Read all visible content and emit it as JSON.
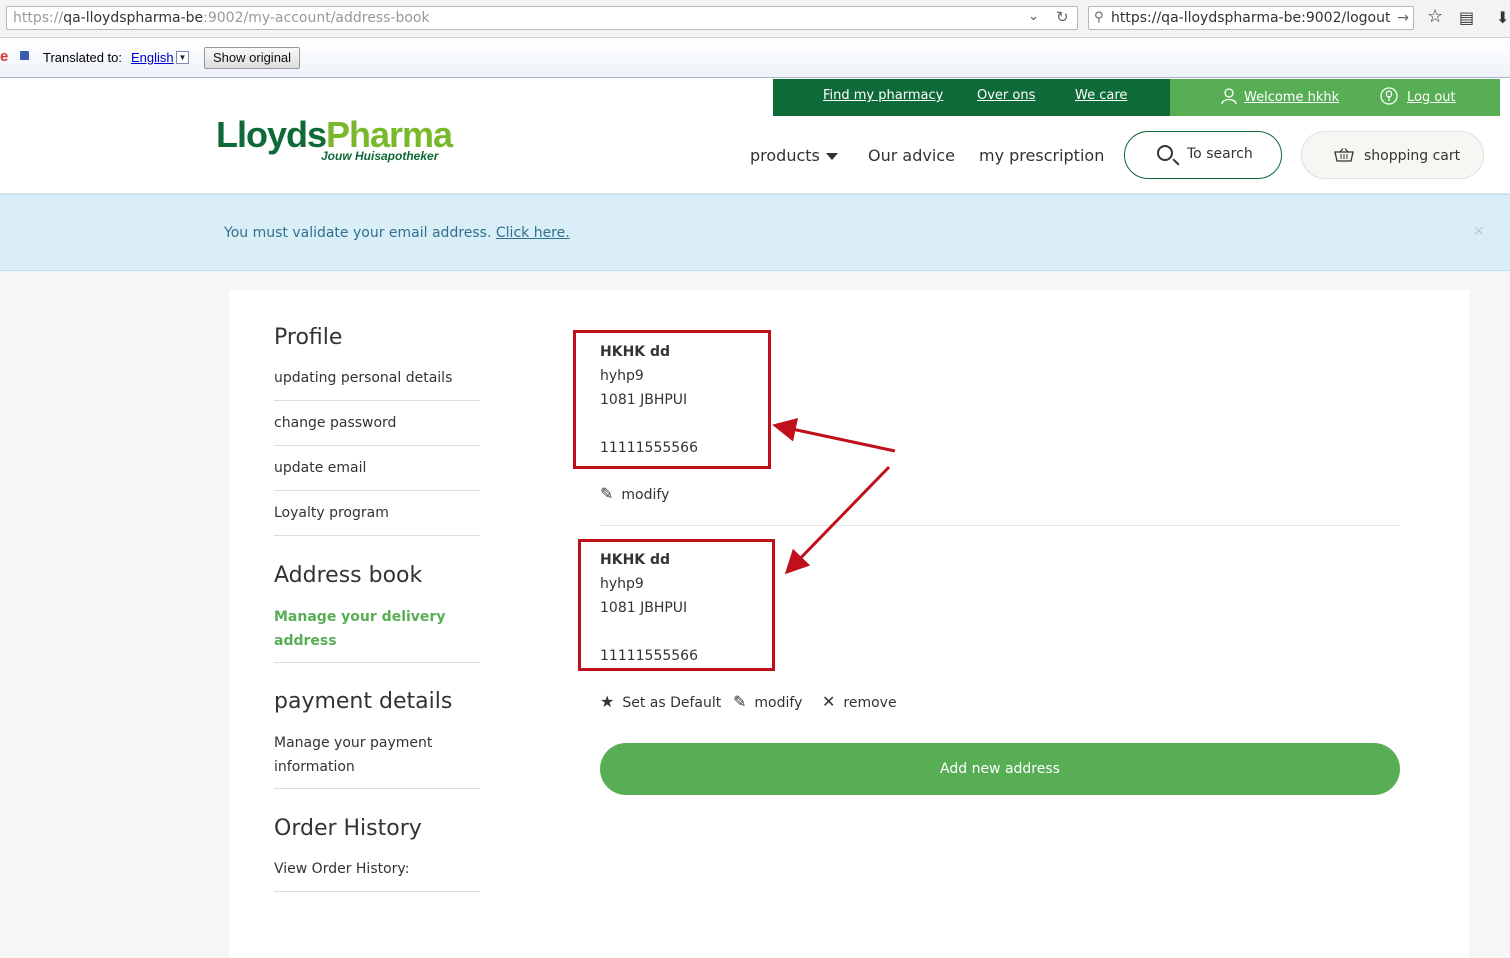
{
  "browser": {
    "url_prefix": "https://",
    "url_host": "qa-lloydspharma-be",
    "url_rest": ":9002/my-account/address-book",
    "search_value": "https://qa-lloydspharma-be:9002/logout",
    "translate": {
      "label": "Translated to:",
      "language": "English",
      "show_original": "Show original"
    }
  },
  "header": {
    "top_links": [
      "Find my pharmacy",
      "Over ons",
      "We care"
    ],
    "welcome": "Welcome hkhk",
    "logout": "Log out",
    "logo_part1": "Lloyds",
    "logo_part2": "Pharma",
    "logo_tagline": "Jouw Huisapotheker",
    "nav": {
      "products": "products",
      "advice": "Our advice",
      "prescription": "my prescription"
    },
    "search_label": "To search",
    "cart_label": "shopping cart"
  },
  "alert": {
    "message": "You must validate your email address. ",
    "link": "Click here.",
    "close": "×"
  },
  "sidebar": {
    "profile_title": "Profile",
    "profile_links": [
      "updating personal details",
      "change password",
      "update email",
      "Loyalty program"
    ],
    "address_title": "Address book",
    "address_active": "Manage your delivery address",
    "payment_title": "payment details",
    "payment_link": "Manage your payment information",
    "order_title": "Order History",
    "order_link": "View Order History:"
  },
  "addresses": [
    {
      "name": "HKHK dd",
      "street": "hyhp9",
      "postal": "1081 JBHPUI",
      "phone": "11111555566"
    },
    {
      "name": "HKHK dd",
      "street": "hyhp9",
      "postal": "1081 JBHPUI",
      "phone": "11111555566"
    }
  ],
  "actions": {
    "modify": "modify",
    "set_default": "Set as Default",
    "remove": "remove"
  },
  "add_address": "Add new address",
  "colors": {
    "dark_green": "#0e6a36",
    "light_green": "#57ae55",
    "annotation_red": "#c0101c",
    "alert_bg": "#d9eef7"
  }
}
